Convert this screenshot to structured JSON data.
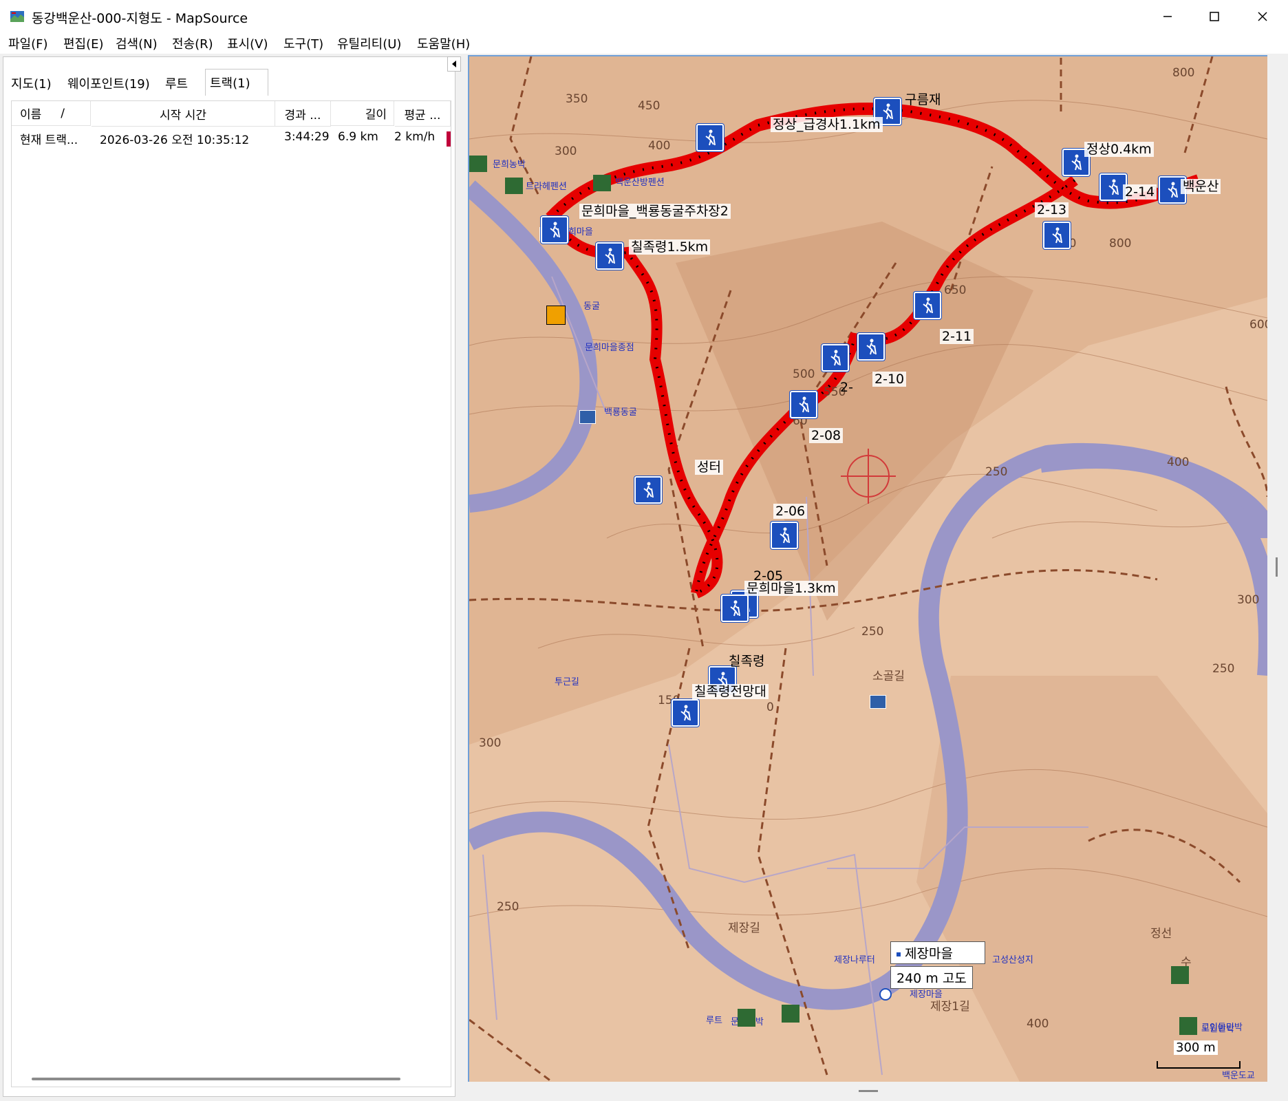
{
  "window": {
    "title": "동강백운산-000-지형도 - MapSource"
  },
  "menu": [
    "파일(F)",
    "편집(E)",
    "검색(N)",
    "전송(R)",
    "표시(V)",
    "도구(T)",
    "유틸리티(U)",
    "도움말(H)"
  ],
  "tabs": [
    "지도(1)",
    "웨이포인트(19)",
    "루트",
    "트랙(1)"
  ],
  "track_table": {
    "headers": [
      "이름",
      "/",
      "시작 시간",
      "경과 ...",
      "길이",
      "평균 ..."
    ],
    "row": [
      "현재 트랙...",
      "2026-03-26 오전 10:35:12",
      "3:44:29",
      "6.9 km",
      "2 km/h"
    ]
  },
  "waypoints": [
    {
      "label": "구름재"
    },
    {
      "label": "정상_급경사1.1km"
    },
    {
      "label": "정상0.4km"
    },
    {
      "label": "백운산"
    },
    {
      "label": "2-14"
    },
    {
      "label": "2-13"
    },
    {
      "label": "문희마을_백룡동굴주차장2"
    },
    {
      "label": "칠족령1.5km"
    },
    {
      "label": "2-11"
    },
    {
      "label": "2-10"
    },
    {
      "label": "2-"
    },
    {
      "label": "2-08"
    },
    {
      "label": "성터"
    },
    {
      "label": "2-06"
    },
    {
      "label": "2-05"
    },
    {
      "label": "문희마을1.3km"
    },
    {
      "label": "칠족령"
    },
    {
      "label": "칠족령전망대"
    }
  ],
  "contours": [
    "350",
    "450",
    "400",
    "300",
    "650",
    "750",
    "800",
    "850",
    "500",
    "550",
    "60",
    "250",
    "400",
    "600",
    "300",
    "250",
    "250",
    "300",
    "250",
    "400",
    "150",
    "0",
    "800"
  ],
  "pois": [
    "문희농박",
    "트라헤펜션",
    "백운산방펜션",
    "문희마을",
    "동굴",
    "문희마을종점",
    "백룡동굴",
    "제장나루터",
    "고성산성지",
    "정선",
    "제장마을",
    "제장1길",
    "소골길",
    "제장길",
    "백운도교",
    "도원민박",
    "수",
    "고인돌민박",
    "문희농박",
    "루트",
    "투근길"
  ],
  "tooltip": {
    "name": "제장마을",
    "elevation": "240 m 고도"
  },
  "scale": "300 m",
  "colors": {
    "track": "#e60000",
    "waypoint_icon": "#1c4fbd",
    "river": "#9a96c8",
    "terrain": "#e8c3a4",
    "trail": "#8b4a2b"
  }
}
